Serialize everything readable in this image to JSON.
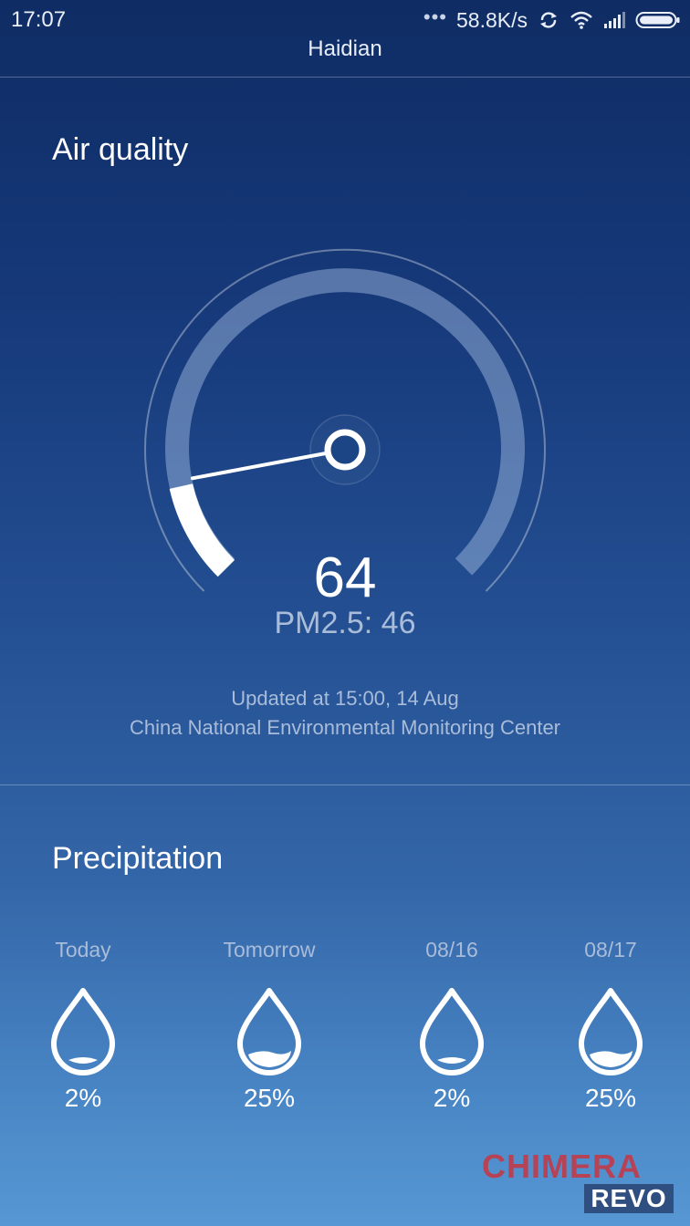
{
  "status_bar": {
    "time": "17:07",
    "network_speed": "58.8K/s",
    "icons": [
      "more-dots-icon",
      "sync-icon",
      "wifi-icon",
      "signal-icon",
      "battery-icon"
    ]
  },
  "header": {
    "title": "Haidian"
  },
  "air_quality": {
    "title": "Air quality",
    "aqi": "64",
    "pm25": "PM2.5: 46",
    "updated": "Updated at 15:00, 14 Aug",
    "source": "China National Environmental Monitoring Center",
    "gauge_level_fraction": 0.12
  },
  "precipitation": {
    "title": "Precipitation",
    "days": [
      {
        "label": "Today",
        "value": "2%",
        "level": 0.02
      },
      {
        "label": "Tomorrow",
        "value": "25%",
        "level": 0.25
      },
      {
        "label": "08/16",
        "value": "2%",
        "level": 0.02
      },
      {
        "label": "08/17",
        "value": "25%",
        "level": 0.25
      }
    ]
  },
  "watermark": {
    "top": "CHIMERA",
    "bottom": "REVO"
  },
  "colors": {
    "background_top": "#0f2c64",
    "background_bottom": "#5797d4",
    "secondary_text": "#a9bcd9",
    "watermark_red": "#c23a4a"
  }
}
